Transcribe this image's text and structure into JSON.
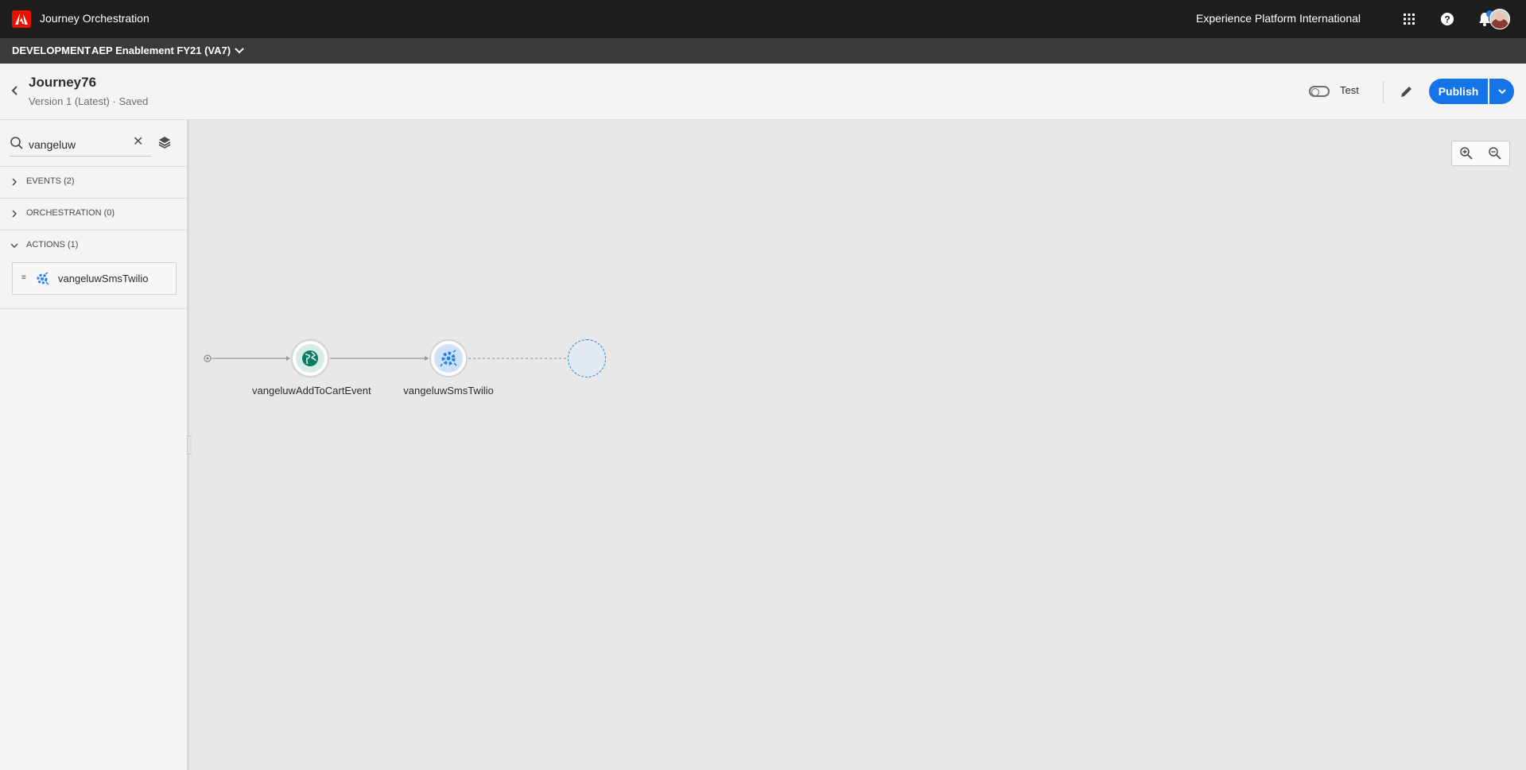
{
  "topbar": {
    "app_title": "Journey Orchestration",
    "org_name": "Experience Platform International",
    "icons": [
      "adobe-logo",
      "apps-grid-icon",
      "help-icon",
      "notifications-icon",
      "avatar"
    ]
  },
  "sandbox": {
    "environment": "DEVELOPMENT",
    "name": "AEP Enablement FY21 (VA7)"
  },
  "journey": {
    "name": "Journey76",
    "version": "Version 1 (Latest) · Saved",
    "test_label": "Test",
    "publish_label": "Publish"
  },
  "sidebar": {
    "search": {
      "value": "vangeluw",
      "placeholder": "Search"
    },
    "sections": [
      {
        "label": "EVENTS (2)",
        "expanded": false
      },
      {
        "label": "ORCHESTRATION (0)",
        "expanded": false
      },
      {
        "label": "ACTIONS (1)",
        "expanded": true
      }
    ],
    "actions": [
      {
        "label": "vangeluwSmsTwilio",
        "icon": "custom-action-icon"
      }
    ]
  },
  "canvas": {
    "nodes": [
      {
        "label": "vangeluwAddToCartEvent",
        "type": "event",
        "icon": "globe-event-icon"
      },
      {
        "label": "vangeluwSmsTwilio",
        "type": "action",
        "icon": "custom-action-icon"
      },
      {
        "label": "",
        "type": "empty-placeholder"
      }
    ]
  },
  "colors": {
    "accent": "#1473e6",
    "topbar": "#1e1e1e",
    "sandbox_bar": "#3a3a3a",
    "event_node": "#0f7a64",
    "action_node": "#2680eb"
  }
}
